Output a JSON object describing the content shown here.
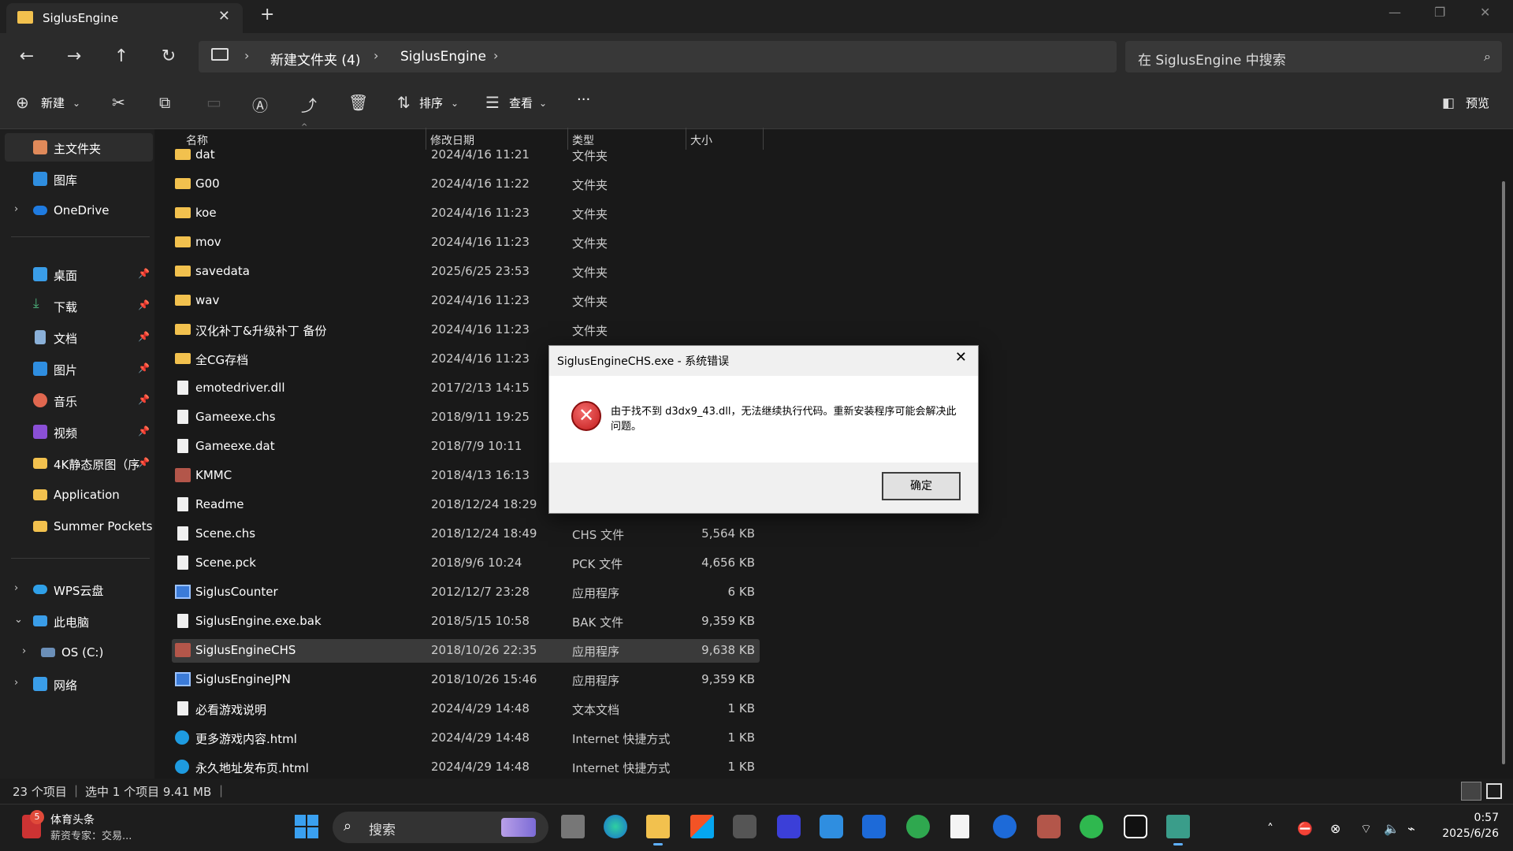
{
  "window": {
    "tab_title": "SiglusEngine",
    "close_tab": "✕",
    "new_tab": "+",
    "minimize": "—",
    "restore": "❐",
    "close": "✕"
  },
  "nav": {
    "back": "←",
    "forward": "→",
    "up": "↑",
    "refresh": "↻",
    "breadcrumbs": [
      "新建文件夹 (4)",
      "SiglusEngine"
    ],
    "search_placeholder": "在 SiglusEngine 中搜索"
  },
  "toolbar": {
    "new_label": "新建",
    "sort_label": "排序",
    "view_label": "查看",
    "more_label": "···",
    "preview_label": "预览"
  },
  "sidebar": {
    "items": [
      {
        "label": "主文件夹",
        "icon": "home-icon",
        "selected": true
      },
      {
        "label": "图库",
        "icon": "gallery-icon"
      },
      {
        "label": "OneDrive",
        "icon": "cloud-icon",
        "expandable": true
      },
      {
        "label": "桌面",
        "icon": "desktop-icon",
        "pinned": true
      },
      {
        "label": "下载",
        "icon": "download-icon",
        "pinned": true
      },
      {
        "label": "文档",
        "icon": "document-icon",
        "pinned": true
      },
      {
        "label": "图片",
        "icon": "picture-icon",
        "pinned": true
      },
      {
        "label": "音乐",
        "icon": "music-icon",
        "pinned": true
      },
      {
        "label": "视频",
        "icon": "video-icon",
        "pinned": true
      },
      {
        "label": "4K静态原图（序",
        "icon": "folder-icon",
        "pinned": true
      },
      {
        "label": "Application",
        "icon": "folder-icon"
      },
      {
        "label": "Summer Pockets",
        "icon": "folder-icon"
      },
      {
        "label": "WPS云盘",
        "icon": "cloud-icon",
        "expandable": true
      },
      {
        "label": "此电脑",
        "icon": "computer-icon",
        "expanded": true
      },
      {
        "label": "OS (C:)",
        "icon": "drive-icon",
        "expandable": true
      },
      {
        "label": "网络",
        "icon": "network-icon",
        "expandable": true
      }
    ]
  },
  "columns": {
    "name": "名称",
    "date": "修改日期",
    "type": "类型",
    "size": "大小"
  },
  "files": [
    {
      "name": "dat",
      "date": "2024/4/16 11:21",
      "type": "文件夹",
      "size": "",
      "icon": "folder"
    },
    {
      "name": "G00",
      "date": "2024/4/16 11:22",
      "type": "文件夹",
      "size": "",
      "icon": "folder"
    },
    {
      "name": "koe",
      "date": "2024/4/16 11:23",
      "type": "文件夹",
      "size": "",
      "icon": "folder"
    },
    {
      "name": "mov",
      "date": "2024/4/16 11:23",
      "type": "文件夹",
      "size": "",
      "icon": "folder"
    },
    {
      "name": "savedata",
      "date": "2025/6/25 23:53",
      "type": "文件夹",
      "size": "",
      "icon": "folder"
    },
    {
      "name": "wav",
      "date": "2024/4/16 11:23",
      "type": "文件夹",
      "size": "",
      "icon": "folder"
    },
    {
      "name": "汉化补丁&升级补丁 备份",
      "date": "2024/4/16 11:23",
      "type": "文件夹",
      "size": "",
      "icon": "folder"
    },
    {
      "name": "全CG存档",
      "date": "2024/4/16 11:23",
      "type": "",
      "size": "",
      "icon": "folder"
    },
    {
      "name": "emotedriver.dll",
      "date": "2017/2/13 14:15",
      "type": "",
      "size": "",
      "icon": "doc"
    },
    {
      "name": "Gameexe.chs",
      "date": "2018/9/11 19:25",
      "type": "",
      "size": "",
      "icon": "doc"
    },
    {
      "name": "Gameexe.dat",
      "date": "2018/7/9 10:11",
      "type": "",
      "size": "",
      "icon": "doc"
    },
    {
      "name": "KMMC",
      "date": "2018/4/13 16:13",
      "type": "",
      "size": "",
      "icon": "anime"
    },
    {
      "name": "Readme",
      "date": "2018/12/24 18:29",
      "type": "",
      "size": "",
      "icon": "doc"
    },
    {
      "name": "Scene.chs",
      "date": "2018/12/24 18:49",
      "type": "CHS 文件",
      "size": "5,564 KB",
      "icon": "doc"
    },
    {
      "name": "Scene.pck",
      "date": "2018/9/6 10:24",
      "type": "PCK 文件",
      "size": "4,656 KB",
      "icon": "doc"
    },
    {
      "name": "SiglusCounter",
      "date": "2012/12/7 23:28",
      "type": "应用程序",
      "size": "6 KB",
      "icon": "app"
    },
    {
      "name": "SiglusEngine.exe.bak",
      "date": "2018/5/15 10:58",
      "type": "BAK 文件",
      "size": "9,359 KB",
      "icon": "doc"
    },
    {
      "name": "SiglusEngineCHS",
      "date": "2018/10/26 22:35",
      "type": "应用程序",
      "size": "9,638 KB",
      "icon": "anime",
      "selected": true
    },
    {
      "name": "SiglusEngineJPN",
      "date": "2018/10/26 15:46",
      "type": "应用程序",
      "size": "9,359 KB",
      "icon": "app"
    },
    {
      "name": "必看游戏说明",
      "date": "2024/4/29 14:48",
      "type": "文本文档",
      "size": "1 KB",
      "icon": "doc"
    },
    {
      "name": "更多游戏内容.html",
      "date": "2024/4/29 14:48",
      "type": "Internet 快捷方式",
      "size": "1 KB",
      "icon": "web"
    },
    {
      "name": "永久地址发布页.html",
      "date": "2024/4/29 14:48",
      "type": "Internet 快捷方式",
      "size": "1 KB",
      "icon": "web"
    }
  ],
  "status": {
    "count": "23 个项目",
    "selection": "选中 1 个项目  9.41 MB"
  },
  "dialog": {
    "title": "SiglusEngineCHS.exe - 系统错误",
    "close": "✕",
    "icon_glyph": "✕",
    "message": "由于找不到 d3dx9_43.dll，无法继续执行代码。重新安装程序可能会解决此问题。",
    "ok_label": "确定"
  },
  "taskbar": {
    "news_badge": "5",
    "news_title": "体育头条",
    "news_sub": "薪资专家：交易...",
    "search_label": "搜索",
    "time": "0:57",
    "date": "2025/6/26"
  },
  "colors": {
    "accent": "#3b82f6",
    "error_red": "#c21b1b",
    "folder_yellow": "#f2c14e"
  }
}
